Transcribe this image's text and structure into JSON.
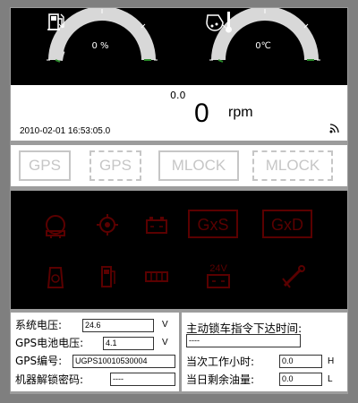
{
  "gauges": {
    "left": {
      "value": "0 %",
      "level": 0,
      "icon": "fuel-pump-icon"
    },
    "right": {
      "value": "0℃",
      "level": 0,
      "icon": "coolant-temperature-icon"
    }
  },
  "rpm": {
    "small_value": "0.0",
    "value": "0",
    "unit": "rpm",
    "timestamp": "2010-02-01 16:53:05.0"
  },
  "status_buttons": [
    {
      "label": "GPS",
      "style": "solid"
    },
    {
      "label": "GPS",
      "style": "dashed"
    },
    {
      "label": "MLOCK",
      "style": "solid"
    },
    {
      "label": "MLOCK",
      "style": "dashed"
    }
  ],
  "indicators": {
    "row1": [
      "engine-warning-icon",
      "oil-pressure-icon",
      "battery-icon",
      "GxS",
      "GxD"
    ],
    "row2": [
      "filter-icon",
      "fuel-filter-icon",
      "preheat-icon",
      "24V",
      "service-wrench-icon"
    ],
    "color": "#5a0000"
  },
  "info_left": {
    "system_voltage_label": "系统电压:",
    "system_voltage_value": "24.6",
    "system_voltage_unit": "V",
    "gps_battery_label": "GPS电池电压:",
    "gps_battery_value": "4.1",
    "gps_battery_unit": "V",
    "gps_id_label": "GPS编号:",
    "gps_id_value": "UGPS10010530004",
    "unlock_code_label": "机器解锁密码:",
    "unlock_code_value": "----"
  },
  "info_right": {
    "lock_command_label": "主动锁车指令下达时间:",
    "lock_command_value": "----",
    "work_hours_label": "当次工作小时:",
    "work_hours_value": "0.0",
    "work_hours_unit": "H",
    "fuel_label": "当日剩余油量:",
    "fuel_value": "0.0",
    "fuel_unit": "L"
  }
}
